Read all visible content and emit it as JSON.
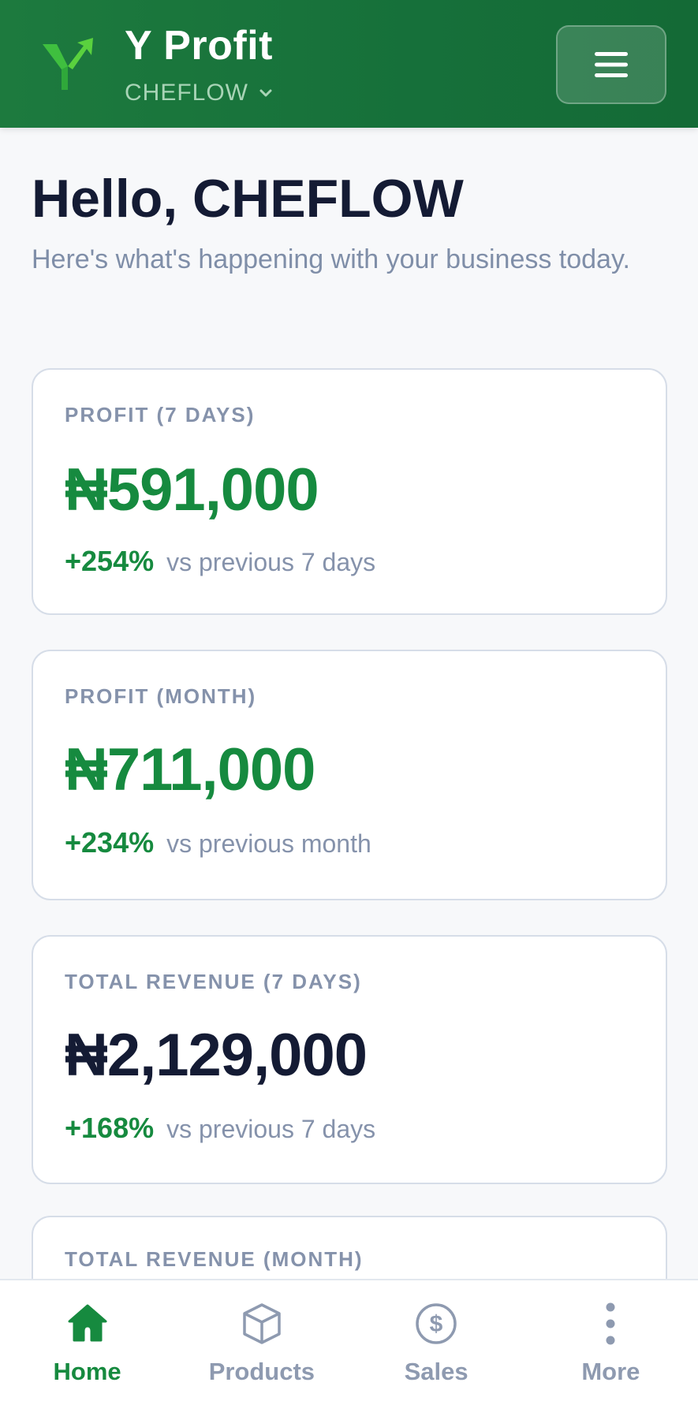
{
  "header": {
    "brand_title": "Y Profit",
    "business_name": "CHEFLOW",
    "colors": {
      "primary": "#1d7a3e",
      "accent_green": "#168a3f"
    }
  },
  "main": {
    "greeting": "Hello, CHEFLOW",
    "subtitle": "Here's what's happening with your business today.",
    "cards": [
      {
        "label": "PROFIT (7 DAYS)",
        "value": "₦591,000",
        "change": "+254%",
        "comparison": "vs previous 7 days"
      },
      {
        "label": "PROFIT (MONTH)",
        "value": "₦711,000",
        "change": "+234%",
        "comparison": "vs previous month"
      },
      {
        "label": "TOTAL REVENUE (7 DAYS)",
        "value": "₦2,129,000",
        "change": "+168%",
        "comparison": "vs previous 7 days"
      },
      {
        "label": "TOTAL REVENUE (MONTH)"
      }
    ]
  },
  "bottom_nav": {
    "items": [
      {
        "label": "Home",
        "icon": "home-icon",
        "active": true
      },
      {
        "label": "Products",
        "icon": "box-icon",
        "active": false
      },
      {
        "label": "Sales",
        "icon": "dollar-circle-icon",
        "active": false
      },
      {
        "label": "More",
        "icon": "more-vertical-icon",
        "active": false
      }
    ]
  }
}
